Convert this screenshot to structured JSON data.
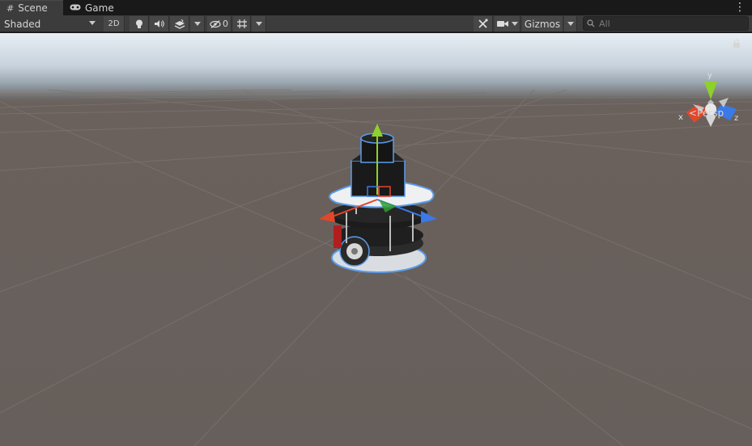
{
  "tabs": [
    {
      "label": "Scene",
      "icon": "grid-icon",
      "active": true
    },
    {
      "label": "Game",
      "icon": "gamepad-icon",
      "active": false
    }
  ],
  "toolbar": {
    "draw_mode": "Shaded",
    "mode_2d": "2D",
    "hidden_count": "0",
    "gizmos_label": "Gizmos",
    "search_placeholder": "All"
  },
  "viewport": {
    "projection_label": "Persp",
    "axes": {
      "x": "x",
      "y": "y",
      "z": "z"
    }
  },
  "colors": {
    "x_axis": "#e2472a",
    "y_axis": "#8dd12a",
    "z_axis": "#3b79e6",
    "selection_outline": "#5b9ce8"
  }
}
